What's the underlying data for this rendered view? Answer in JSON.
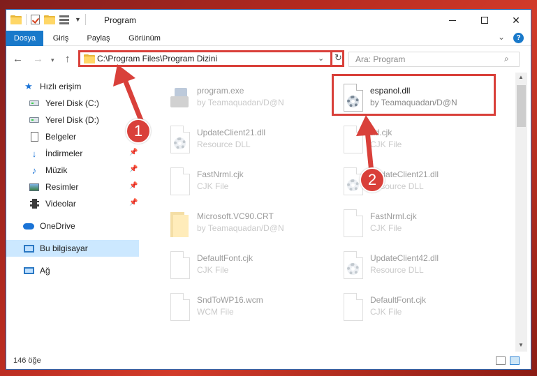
{
  "window": {
    "title": "Program",
    "controls": {
      "minimize": "minimize",
      "maximize": "maximize",
      "close": "✕"
    }
  },
  "ribbon": {
    "tabs": [
      {
        "label": "Dosya",
        "active": true
      },
      {
        "label": "Giriş"
      },
      {
        "label": "Paylaş"
      },
      {
        "label": "Görünüm"
      }
    ],
    "help": "?"
  },
  "nav": {
    "address": "C:\\Program Files\\Program Dizini",
    "search_placeholder": "Ara: Program"
  },
  "sidebar": {
    "items": [
      {
        "label": "Hızlı erişim",
        "icon": "star-icon"
      },
      {
        "label": "Yerel Disk (C:)",
        "icon": "drive-icon"
      },
      {
        "label": "Yerel Disk (D:)",
        "icon": "drive-icon"
      },
      {
        "label": "Belgeler",
        "icon": "document-icon"
      },
      {
        "label": "İndirmeler",
        "icon": "download-icon",
        "pinned": true
      },
      {
        "label": "Müzik",
        "icon": "music-icon",
        "pinned": true
      },
      {
        "label": "Resimler",
        "icon": "pictures-icon",
        "pinned": true
      },
      {
        "label": "Videolar",
        "icon": "videos-icon",
        "pinned": true
      },
      {
        "label": "OneDrive",
        "icon": "cloud-icon"
      },
      {
        "label": "Bu bilgisayar",
        "icon": "computer-icon",
        "selected": true
      },
      {
        "label": "Ağ",
        "icon": "network-icon"
      }
    ]
  },
  "files": [
    {
      "name": "program.exe",
      "sub": "by Teamaquadan/D@N",
      "icon": "exe-icon"
    },
    {
      "name": "espanol.dll",
      "sub": "by Teamaquadan/D@N",
      "icon": "dll-icon",
      "highlighted": true
    },
    {
      "name": "UpdateClient21.dll",
      "sub": "Resource DLL",
      "icon": "dll-icon"
    },
    {
      "name": "ad.cjk",
      "sub": "CJK File",
      "icon": "file-icon"
    },
    {
      "name": "FastNrml.cjk",
      "sub": "CJK File",
      "icon": "file-icon"
    },
    {
      "name": "UpdateClient21.dll",
      "sub": "Resource DLL",
      "icon": "dll-icon"
    },
    {
      "name": "Microsoft.VC90.CRT",
      "sub": "by Teamaquadan/D@N",
      "icon": "folder-icon"
    },
    {
      "name": "FastNrml.cjk",
      "sub": "CJK File",
      "icon": "file-icon"
    },
    {
      "name": "DefaultFont.cjk",
      "sub": "CJK File",
      "icon": "file-icon"
    },
    {
      "name": "UpdateClient42.dll",
      "sub": "Resource DLL",
      "icon": "dll-icon"
    },
    {
      "name": "SndToWP16.wcm",
      "sub": "WCM File",
      "icon": "file-icon"
    },
    {
      "name": "DefaultFont.cjk",
      "sub": "CJK File",
      "icon": "file-icon"
    }
  ],
  "status": {
    "count": "146 öğe"
  },
  "callouts": [
    "1",
    "2"
  ],
  "colors": {
    "accent": "#1979ca",
    "highlight": "#d9403a",
    "selection": "#cce8ff"
  }
}
